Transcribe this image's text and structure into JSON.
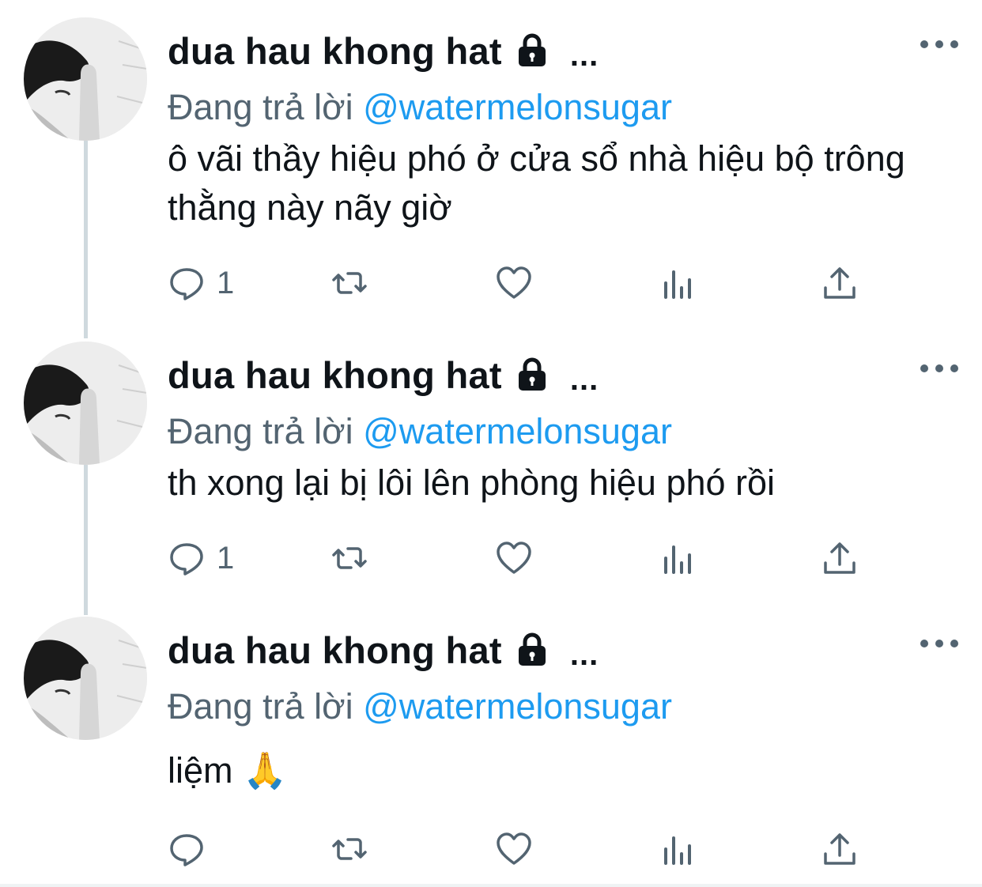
{
  "tweets": [
    {
      "display_name": "dua hau khong hat",
      "more_inline": "...",
      "reply_prefix": "Đang trả lời ",
      "reply_handle": "@watermelonsugar",
      "text": "ô vãi thầy hiệu phó ở cửa sổ nhà hiệu bộ trông thằng này nãy giờ",
      "reply_count": "1"
    },
    {
      "display_name": "dua hau khong hat",
      "more_inline": "...",
      "reply_prefix": "Đang trả lời ",
      "reply_handle": "@watermelonsugar",
      "text": "th xong lại bị lôi lên phòng hiệu phó rồi",
      "reply_count": "1"
    },
    {
      "display_name": "dua hau khong hat",
      "more_inline": "...",
      "reply_prefix": "Đang trả lời ",
      "reply_handle": "@watermelonsugar",
      "text": "liệm 🙏",
      "reply_count": ""
    }
  ],
  "icons": [
    "lock-icon",
    "more-icon",
    "reply-icon",
    "retweet-icon",
    "like-icon",
    "views-icon",
    "share-icon"
  ],
  "colors": {
    "link": "#1d9bf0",
    "secondary": "#536471",
    "text": "#0f1419",
    "thread_line": "#cfd9de"
  }
}
